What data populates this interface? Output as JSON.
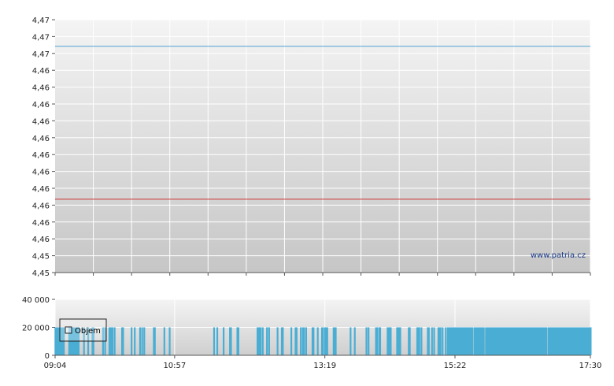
{
  "watermark": "www.patria.cz",
  "chart_data": [
    {
      "type": "line",
      "y_tick_labels": [
        "4,47",
        "4,47",
        "4,47",
        "4,46",
        "4,46",
        "4,46",
        "4,46",
        "4,46",
        "4,46",
        "4,46",
        "4,46",
        "4,46",
        "4,46",
        "4,46",
        "4,45",
        "4,45"
      ],
      "ylim": [
        4.45,
        4.47
      ],
      "series": [
        {
          "values": [
            4.4679,
            4.4679
          ],
          "x": [
            "09:04",
            "17:30"
          ],
          "color": "#4aa3d0"
        },
        {
          "values": [
            4.4558,
            4.4558
          ],
          "x": [
            "09:04",
            "17:30"
          ],
          "color": "#cc3333"
        }
      ],
      "grid": true
    },
    {
      "type": "bar",
      "legend": {
        "label": "Objem",
        "position": "top-left"
      },
      "color": "#4aaed4",
      "ylim": [
        0,
        40000
      ],
      "y_tick_labels": [
        "40 000",
        "20 000",
        "0"
      ],
      "y_tick_values": [
        40000,
        20000,
        0
      ],
      "x_tick_labels": [
        "09:04",
        "10:57",
        "13:19",
        "15:22",
        "17:30"
      ],
      "x_tick_values": [
        "09:04",
        "10:57",
        "13:19",
        "15:22",
        "17:30"
      ],
      "trade_times": [
        "09:04",
        "09:05",
        "09:06",
        "09:07",
        "09:08",
        "09:09",
        "09:10",
        "09:11",
        "09:12",
        "09:17",
        "09:18",
        "09:19",
        "09:20",
        "09:21",
        "09:22",
        "09:23",
        "09:24",
        "09:25",
        "09:26",
        "09:31",
        "09:35",
        "09:39",
        "09:40",
        "09:49",
        "09:51",
        "09:55",
        "09:56",
        "09:57",
        "09:58",
        "10:00",
        "10:07",
        "10:08",
        "10:16",
        "10:19",
        "10:24",
        "10:26",
        "10:28",
        "10:37",
        "10:38",
        "10:47",
        "10:52",
        "11:34",
        "11:37",
        "11:43",
        "11:49",
        "11:50",
        "11:56",
        "11:57",
        "12:15",
        "12:16",
        "12:17",
        "12:18",
        "12:20",
        "12:24",
        "12:26",
        "12:34",
        "12:38",
        "12:39",
        "12:47",
        "12:51",
        "12:52",
        "12:56",
        "12:58",
        "12:59",
        "13:01",
        "13:07",
        "13:08",
        "13:12",
        "13:16",
        "13:17",
        "13:19",
        "13:20",
        "13:21",
        "13:27",
        "13:28",
        "13:29",
        "13:43",
        "13:47",
        "13:58",
        "14:00",
        "14:07",
        "14:08",
        "14:10",
        "14:11",
        "14:18",
        "14:19",
        "14:20",
        "14:21",
        "14:27",
        "14:28",
        "14:29",
        "14:30",
        "14:38",
        "14:39",
        "14:46",
        "14:47",
        "14:48",
        "14:50",
        "14:56",
        "14:57",
        "15:00",
        "15:02",
        "15:06",
        "15:07",
        "15:08",
        "15:10",
        "15:13",
        "15:15",
        "15:16",
        "15:17",
        "15:18",
        "15:19",
        "15:20",
        "15:21",
        "15:22",
        "15:23",
        "15:24",
        "15:25",
        "15:26",
        "15:27",
        "15:28",
        "15:29",
        "15:30",
        "15:31",
        "15:32",
        "15:33",
        "15:34",
        "15:35",
        "15:36",
        "15:37",
        "15:38",
        "15:40",
        "15:41",
        "15:42",
        "15:43",
        "15:44",
        "15:45",
        "15:46",
        "15:47",
        "15:48",
        "15:49",
        "15:51",
        "15:52",
        "15:53",
        "15:54",
        "15:55",
        "15:56",
        "15:57",
        "15:58",
        "15:59",
        "16:00",
        "16:01",
        "16:02",
        "16:03",
        "16:04",
        "16:05",
        "16:06",
        "16:07",
        "16:08",
        "16:09",
        "16:10",
        "16:11",
        "16:12",
        "16:13",
        "16:14",
        "16:15",
        "16:16",
        "16:17",
        "16:18",
        "16:19",
        "16:20",
        "16:21",
        "16:22",
        "16:23",
        "16:24",
        "16:25",
        "16:26",
        "16:27",
        "16:28",
        "16:29",
        "16:30",
        "16:31",
        "16:32",
        "16:33",
        "16:34",
        "16:35",
        "16:36",
        "16:37",
        "16:38",
        "16:39",
        "16:40",
        "16:41",
        "16:42",
        "16:43",
        "16:44",
        "16:45",
        "16:46",
        "16:47",
        "16:48",
        "16:50",
        "16:51",
        "16:52",
        "16:53",
        "16:54",
        "16:55",
        "16:56",
        "16:57",
        "16:58",
        "16:59",
        "17:00",
        "17:01",
        "17:02",
        "17:03",
        "17:04",
        "17:05",
        "17:06",
        "17:07",
        "17:08",
        "17:09",
        "17:10",
        "17:11",
        "17:12",
        "17:13",
        "17:14",
        "17:15",
        "17:16",
        "17:17",
        "17:18",
        "17:19",
        "17:20",
        "17:21",
        "17:22",
        "17:23",
        "17:24",
        "17:25",
        "17:26",
        "17:27",
        "17:28",
        "17:29",
        "17:30"
      ],
      "trade_volume": 20000,
      "grid": true
    }
  ]
}
